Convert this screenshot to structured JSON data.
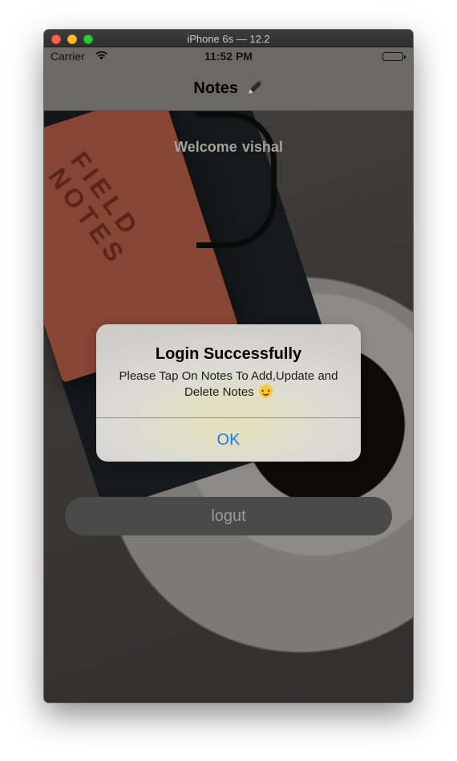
{
  "window": {
    "title": "iPhone 6s — 12.2"
  },
  "status_bar": {
    "carrier": "Carrier",
    "wifi_icon": "wifi-icon",
    "time": "11:52 PM",
    "battery_icon": "battery-icon",
    "battery_level": 1.0
  },
  "nav": {
    "title": "Notes",
    "icon": "pencil-icon"
  },
  "welcome": {
    "greeting": "Welcome",
    "username": "vishal"
  },
  "background_photo": {
    "notebook_text": "FIELD\nNOTES"
  },
  "alert": {
    "title": "Login Successfully",
    "message": "Please Tap On Notes To Add,Update and Delete Notes",
    "emoji_icon": "smiley-icon",
    "ok_label": "OK"
  },
  "logout": {
    "label": "logut"
  },
  "colors": {
    "alert_button": "#1c7ce5",
    "nav_bg": "#6b6966",
    "logout_bg": "#4a4a4a"
  }
}
